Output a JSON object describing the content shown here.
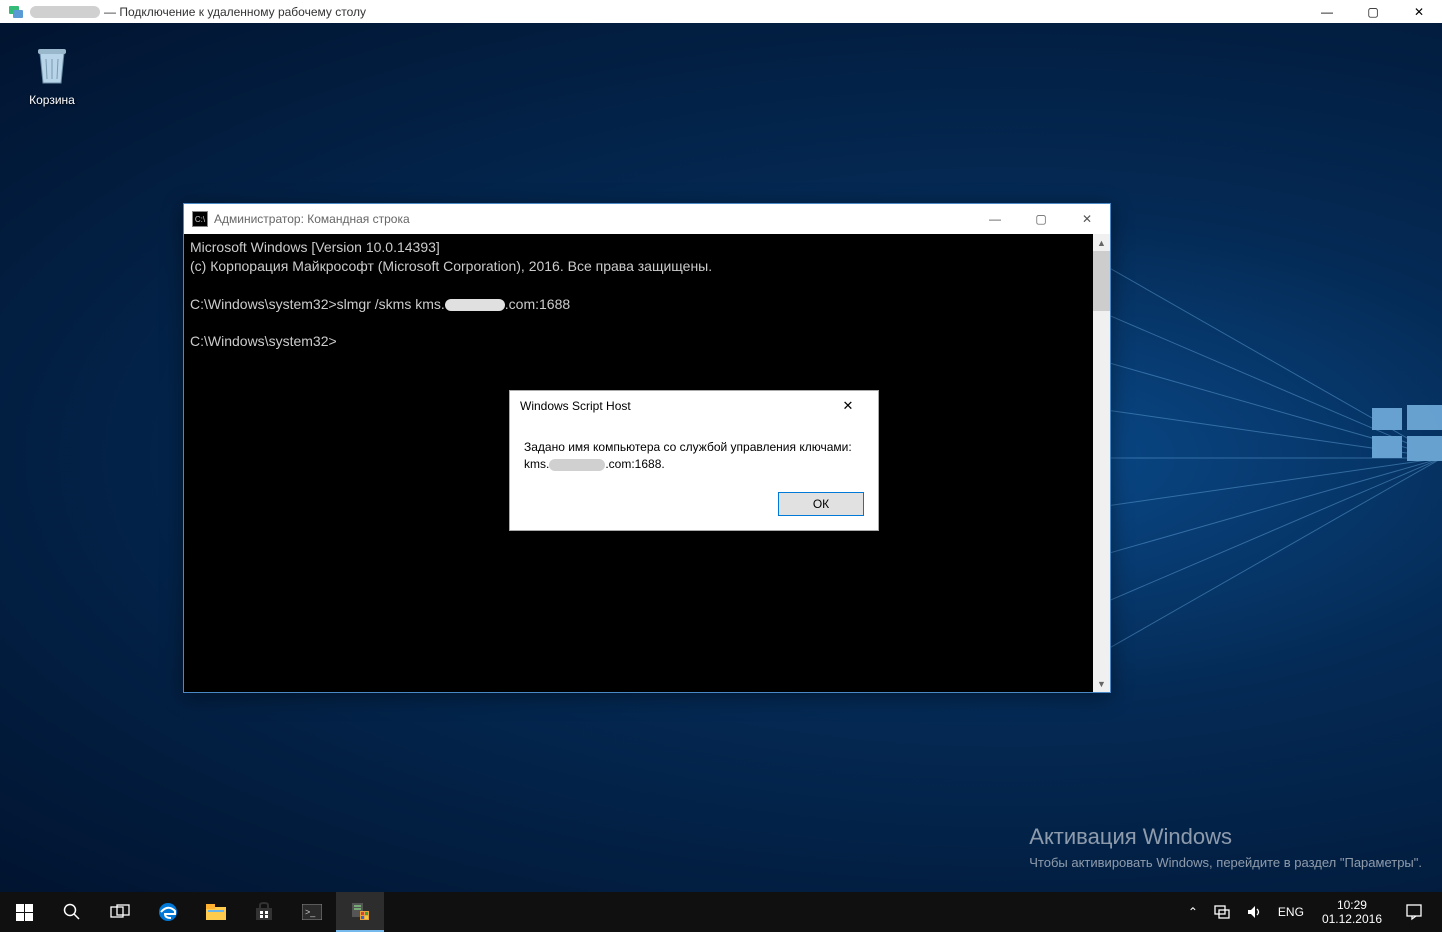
{
  "rdp": {
    "title": "— Подключение к удаленному рабочему столу",
    "controls": {
      "minimize": "—",
      "maximize": "▢",
      "close": "✕"
    }
  },
  "desktop": {
    "recycle_bin_label": "Корзина"
  },
  "watermark": {
    "title": "Активация Windows",
    "subtitle": "Чтобы активировать Windows, перейдите в раздел \"Параметры\"."
  },
  "cmd": {
    "title": "Администратор: Командная строка",
    "line1": "Microsoft Windows [Version 10.0.14393]",
    "line2": "(c) Корпорация Майкрософт (Microsoft Corporation), 2016. Все права защищены.",
    "line3_prefix": "C:\\Windows\\system32>slmgr /skms kms.",
    "line3_suffix": ".com:1688",
    "line4": "C:\\Windows\\system32>",
    "controls": {
      "minimize": "—",
      "maximize": "▢",
      "close": "✕"
    }
  },
  "dialog": {
    "title": "Windows Script Host",
    "body_line1": "Задано имя компьютера со службой управления ключами:",
    "body_line2_prefix": "kms.",
    "body_line2_suffix": ".com:1688.",
    "ok_label": "ОК",
    "close_glyph": "✕"
  },
  "taskbar": {
    "lang": "ENG",
    "time": "10:29",
    "date": "01.12.2016",
    "tray_chevron": "⌃"
  }
}
